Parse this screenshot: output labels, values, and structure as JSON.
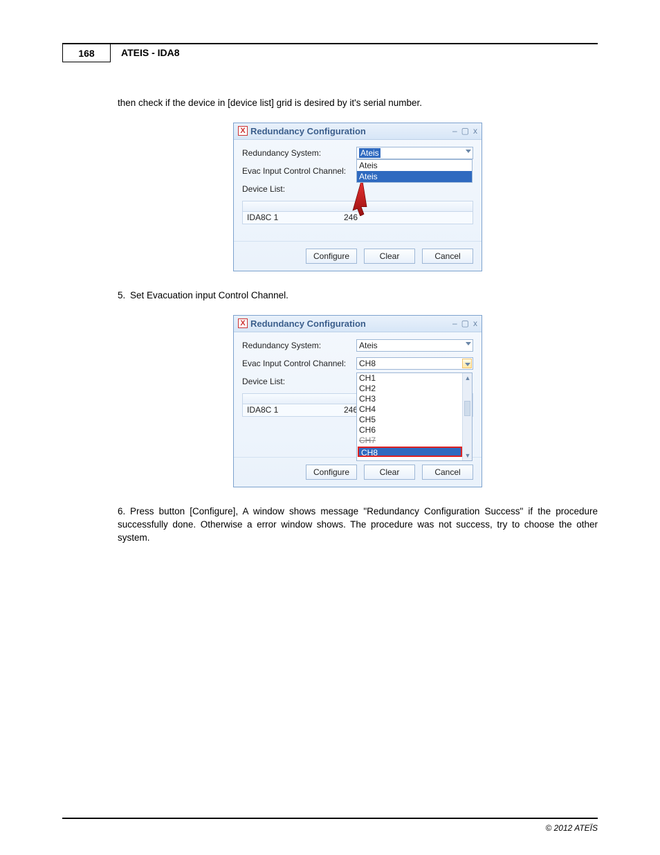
{
  "page": {
    "number": "168",
    "header": "ATEIS - IDA8",
    "copyright": "© 2012 ATEÏS"
  },
  "text": {
    "intro": "then check if the device in [device list] grid is desired by it's serial number.",
    "step5": "Set Evacuation input Control Channel.",
    "step6": "Press button [Configure], A window shows message \"Redundancy Configuration Success\" if the procedure successfully done. Otherwise a error window shows. The procedure was not success, try to choose the other system."
  },
  "dialog": {
    "title": "Redundancy Configuration",
    "labels": {
      "system": "Redundancy System:",
      "channel": "Evac Input Control Channel:",
      "devlist": "Device List:"
    },
    "buttons": {
      "configure": "Configure",
      "clear": "Clear",
      "cancel": "Cancel"
    }
  },
  "dlg1": {
    "system_selected": "Ateis",
    "system_options": [
      "Ateis",
      "Ateis"
    ],
    "dev_name": "IDA8C 1",
    "dev_serial": "246"
  },
  "dlg2": {
    "system_value": "Ateis",
    "channel_selected": "CH8",
    "channel_options": [
      "CH1",
      "CH2",
      "CH3",
      "CH4",
      "CH5",
      "CH6",
      "CH7",
      "CH8"
    ],
    "dev_name": "IDA8C 1",
    "dev_serial": "246"
  }
}
